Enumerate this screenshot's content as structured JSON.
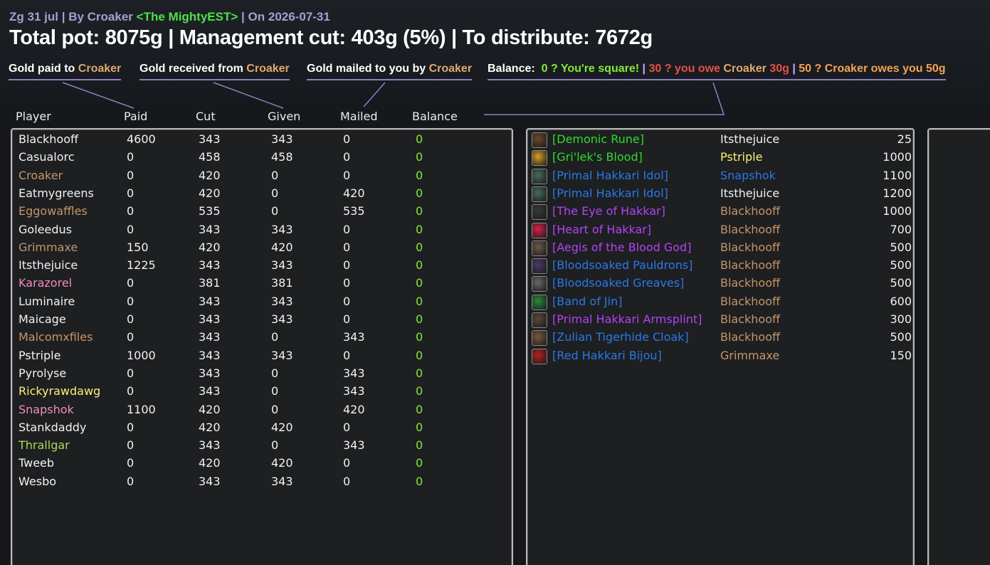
{
  "header": {
    "raid": "Zg 31 jul",
    "by_prefix": "By",
    "leader": "Croaker",
    "guild": "<The MightyEST>",
    "on_prefix": "On",
    "date": "2026-07-31"
  },
  "summary": {
    "pot_label": "Total pot:",
    "pot": "8075g",
    "cut_label": "Management cut:",
    "cut": "403g (5%)",
    "dist_label": "To distribute:",
    "dist": "7672g"
  },
  "legend": {
    "paid_prefix": "Gold paid to",
    "received_prefix": "Gold received from",
    "mailed_prefix": "Gold mailed to you by",
    "name": "Croaker",
    "balance_label": "Balance:",
    "square": "0 ? You're square!",
    "owe_prefix": "30 ? you owe",
    "owe_name": "Croaker",
    "owe_amt": "30g",
    "owes_text": "50 ? Croaker owes you 50g"
  },
  "columns": [
    "Player",
    "Paid",
    "Cut",
    "Given",
    "Mailed",
    "Balance"
  ],
  "colors": {
    "white": "#f2f2f2",
    "tan": "#c4966a",
    "pink": "#f08cc0",
    "yellow": "#f7f27a",
    "lime": "#a8d85a",
    "green_bal": "#84e83a",
    "epic": "#b044f5",
    "rare": "#2a78e8",
    "uncommon": "#2ddc2d"
  },
  "players": [
    {
      "name": "Blackhooff",
      "color": "#f2f2f2",
      "paid": "4600",
      "cut": "343",
      "given": "343",
      "mailed": "0",
      "balance": "0"
    },
    {
      "name": "Casualorc",
      "color": "#f2f2f2",
      "paid": "0",
      "cut": "458",
      "given": "458",
      "mailed": "0",
      "balance": "0"
    },
    {
      "name": "Croaker",
      "color": "#c4966a",
      "paid": "0",
      "cut": "420",
      "given": "0",
      "mailed": "0",
      "balance": "0"
    },
    {
      "name": "Eatmygreens",
      "color": "#f2f2f2",
      "paid": "0",
      "cut": "420",
      "given": "0",
      "mailed": "420",
      "balance": "0"
    },
    {
      "name": "Eggowaffles",
      "color": "#c4966a",
      "paid": "0",
      "cut": "535",
      "given": "0",
      "mailed": "535",
      "balance": "0"
    },
    {
      "name": "Goleedus",
      "color": "#f2f2f2",
      "paid": "0",
      "cut": "343",
      "given": "343",
      "mailed": "0",
      "balance": "0"
    },
    {
      "name": "Grimmaxe",
      "color": "#c4966a",
      "paid": "150",
      "cut": "420",
      "given": "420",
      "mailed": "0",
      "balance": "0"
    },
    {
      "name": "Itsthejuice",
      "color": "#f2f2f2",
      "paid": "1225",
      "cut": "343",
      "given": "343",
      "mailed": "0",
      "balance": "0"
    },
    {
      "name": "Karazorel",
      "color": "#f08cc0",
      "paid": "0",
      "cut": "381",
      "given": "381",
      "mailed": "0",
      "balance": "0"
    },
    {
      "name": "Luminaire",
      "color": "#f2f2f2",
      "paid": "0",
      "cut": "343",
      "given": "343",
      "mailed": "0",
      "balance": "0"
    },
    {
      "name": "Maicage",
      "color": "#f2f2f2",
      "paid": "0",
      "cut": "343",
      "given": "343",
      "mailed": "0",
      "balance": "0"
    },
    {
      "name": "Malcomxfiles",
      "color": "#c4966a",
      "paid": "0",
      "cut": "343",
      "given": "0",
      "mailed": "343",
      "balance": "0"
    },
    {
      "name": "Pstriple",
      "color": "#f2f2f2",
      "paid": "1000",
      "cut": "343",
      "given": "343",
      "mailed": "0",
      "balance": "0"
    },
    {
      "name": "Pyrolyse",
      "color": "#f2f2f2",
      "paid": "0",
      "cut": "343",
      "given": "0",
      "mailed": "343",
      "balance": "0"
    },
    {
      "name": "Rickyrawdawg",
      "color": "#f7f27a",
      "paid": "0",
      "cut": "343",
      "given": "0",
      "mailed": "343",
      "balance": "0"
    },
    {
      "name": "Snapshok",
      "color": "#f08cc0",
      "paid": "1100",
      "cut": "420",
      "given": "0",
      "mailed": "420",
      "balance": "0"
    },
    {
      "name": "Stankdaddy",
      "color": "#f2f2f2",
      "paid": "0",
      "cut": "420",
      "given": "420",
      "mailed": "0",
      "balance": "0"
    },
    {
      "name": "Thrallgar",
      "color": "#a8d85a",
      "paid": "0",
      "cut": "343",
      "given": "0",
      "mailed": "343",
      "balance": "0"
    },
    {
      "name": "Tweeb",
      "color": "#f2f2f2",
      "paid": "0",
      "cut": "420",
      "given": "420",
      "mailed": "0",
      "balance": "0"
    },
    {
      "name": "Wesbo",
      "color": "#f2f2f2",
      "paid": "0",
      "cut": "343",
      "given": "343",
      "mailed": "0",
      "balance": "0"
    }
  ],
  "items": [
    {
      "name": "[Demonic Rune]",
      "color": "#2ddc2d",
      "icon": "demonic-rune-icon",
      "icon_color": "#6a4a2a",
      "winner": "Itsthejuice",
      "winner_color": "#f2f2f2",
      "price": "25"
    },
    {
      "name": "[Gri'lek's Blood]",
      "color": "#2ddc2d",
      "icon": "blood-vial-icon",
      "icon_color": "#d8a020",
      "winner": "Pstriple",
      "winner_color": "#f7f27a",
      "price": "1000"
    },
    {
      "name": "[Primal Hakkari Idol]",
      "color": "#2a78e8",
      "icon": "idol-icon",
      "icon_color": "#4a6a5a",
      "winner": "Snapshok",
      "winner_color": "#2a78e8",
      "price": "1100"
    },
    {
      "name": "[Primal Hakkari Idol]",
      "color": "#2a78e8",
      "icon": "idol-icon",
      "icon_color": "#4a6a5a",
      "winner": "Itsthejuice",
      "winner_color": "#f2f2f2",
      "price": "1200"
    },
    {
      "name": "[The Eye of Hakkar]",
      "color": "#b044f5",
      "icon": "eye-icon",
      "icon_color": "#3a3a3a",
      "winner": "Blackhooff",
      "winner_color": "#c4966a",
      "price": "1000"
    },
    {
      "name": "[Heart of Hakkar]",
      "color": "#b044f5",
      "icon": "heart-icon",
      "icon_color": "#d8204a",
      "winner": "Blackhooff",
      "winner_color": "#c4966a",
      "price": "700"
    },
    {
      "name": "[Aegis of the Blood God]",
      "color": "#b044f5",
      "icon": "shield-icon",
      "icon_color": "#6a5a4a",
      "winner": "Blackhooff",
      "winner_color": "#c4966a",
      "price": "500"
    },
    {
      "name": "[Bloodsoaked Pauldrons]",
      "color": "#2a78e8",
      "icon": "pauldrons-icon",
      "icon_color": "#4a3a6a",
      "winner": "Blackhooff",
      "winner_color": "#c4966a",
      "price": "500"
    },
    {
      "name": "[Bloodsoaked Greaves]",
      "color": "#2a78e8",
      "icon": "greaves-icon",
      "icon_color": "#6a6a6a",
      "winner": "Blackhooff",
      "winner_color": "#c4966a",
      "price": "500"
    },
    {
      "name": "[Band of Jin]",
      "color": "#2a78e8",
      "icon": "ring-icon",
      "icon_color": "#2a8a3a",
      "winner": "Blackhooff",
      "winner_color": "#c4966a",
      "price": "600"
    },
    {
      "name": "[Primal Hakkari Armsplint]",
      "color": "#b044f5",
      "icon": "armsplint-icon",
      "icon_color": "#5a4a3a",
      "winner": "Blackhooff",
      "winner_color": "#c4966a",
      "price": "300"
    },
    {
      "name": "[Zulian Tigerhide Cloak]",
      "color": "#2a78e8",
      "icon": "cloak-icon",
      "icon_color": "#7a5a3a",
      "winner": "Blackhooff",
      "winner_color": "#c4966a",
      "price": "500"
    },
    {
      "name": "[Red Hakkari Bijou]",
      "color": "#2a78e8",
      "icon": "bijou-icon",
      "icon_color": "#b82020",
      "winner": "Grimmaxe",
      "winner_color": "#c4966a",
      "price": "150"
    }
  ]
}
